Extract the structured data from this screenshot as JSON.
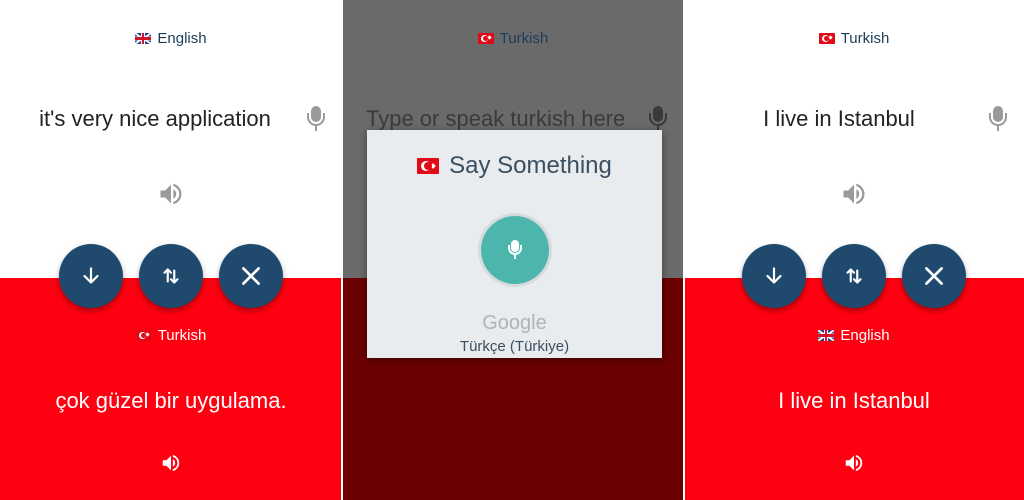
{
  "panels": [
    {
      "source_lang": "English",
      "source_flag": "uk-flag-icon",
      "source_text": "it's very nice application",
      "target_lang": "Turkish",
      "target_flag": "turkey-flag-icon",
      "target_text": "çok güzel bir uygulama."
    },
    {
      "source_lang": "Turkish",
      "source_flag": "turkey-flag-icon",
      "input_placeholder": "Type or speak turkish here",
      "dialog": {
        "title": "Say Something",
        "brand": "Google",
        "locale": "Türkçe (Türkiye)"
      }
    },
    {
      "source_lang": "Turkish",
      "source_flag": "turkey-flag-icon",
      "source_text": "I live in Istanbul",
      "target_lang": "English",
      "target_flag": "uk-flag-icon",
      "target_text": "I live in Istanbul"
    }
  ],
  "buttons": {
    "icons": [
      "arrow-down-icon",
      "swap-icon",
      "close-icon"
    ]
  },
  "colors": {
    "accent_blue": "#1f4a6e",
    "red": "#ff0010",
    "mic_teal": "#4db6ac"
  }
}
